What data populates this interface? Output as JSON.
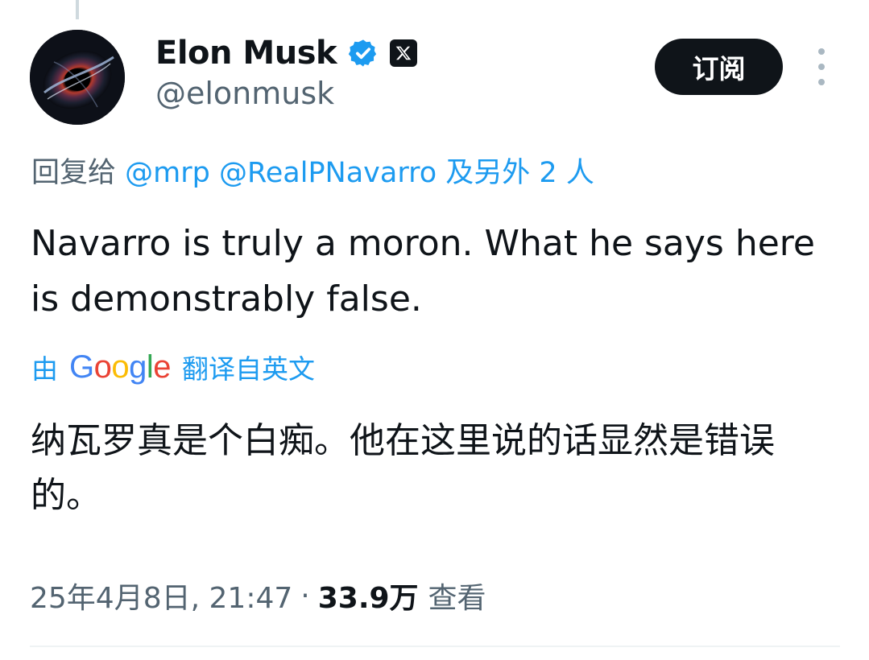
{
  "author": {
    "display_name": "Elon Musk",
    "handle": "@elonmusk",
    "avatar_icon": "black-hole-avatar",
    "verified_icon": "verified-badge-icon",
    "affiliation_icon": "x-logo-icon"
  },
  "actions": {
    "subscribe_label": "订阅",
    "more_icon": "more-vertical-icon"
  },
  "reply": {
    "prefix": "回复给",
    "mentions": [
      "@mrp",
      "@RealPNavarro"
    ],
    "suffix": "及另外 2 人"
  },
  "tweet": {
    "text": "Navarro is truly a moron. What he says here is demonstrably false."
  },
  "translation": {
    "by": "由",
    "provider": "Google",
    "label": "翻译自英文",
    "text": "纳瓦罗真是个白痴。他在这里说的话显然是错误的。"
  },
  "meta": {
    "timestamp": "25年4月8日, 21:47",
    "separator": "·",
    "views_count": "33.9万",
    "views_label": "查看"
  },
  "colors": {
    "text_primary": "#0f1419",
    "text_secondary": "#536471",
    "link": "#1d9bf0",
    "verified": "#1d9bf0",
    "button_bg": "#0f1419",
    "google_blue": "#4285f4",
    "google_red": "#ea4335",
    "google_yellow": "#fbbc05",
    "google_green": "#34a853"
  }
}
